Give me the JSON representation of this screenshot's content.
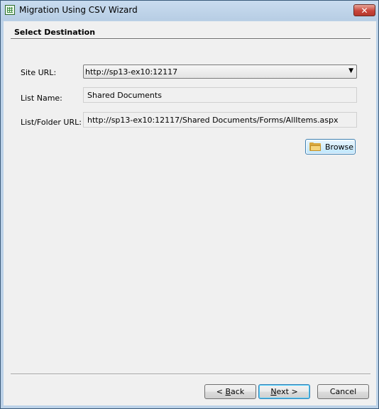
{
  "window": {
    "title": "Migration Using CSV Wizard",
    "close_glyph": "✕"
  },
  "section": {
    "title": "Select Destination"
  },
  "form": {
    "site_url": {
      "label": "Site URL:",
      "value": "http://sp13-ex10:12117"
    },
    "list_name": {
      "label": "List Name:",
      "value": "Shared Documents"
    },
    "folder_url": {
      "label": "List/Folder URL:",
      "value": "http://sp13-ex10:12117/Shared Documents/Forms/AllItems.aspx"
    },
    "browse_label": "Browse"
  },
  "footer": {
    "back_mnemonic": "B",
    "back_rest": "ack",
    "back_prefix": "< ",
    "next_mnemonic": "N",
    "next_rest": "ext >",
    "cancel_label": "Cancel"
  },
  "icons": {
    "app": "grid-table-icon",
    "browse": "folder-icon",
    "dropdown": "dropdown-arrow-icon"
  },
  "colors": {
    "title_bar": "#c9dcef",
    "client": "#f0f0f0",
    "close": "#c8453a",
    "focus": "#3c7fb1"
  }
}
